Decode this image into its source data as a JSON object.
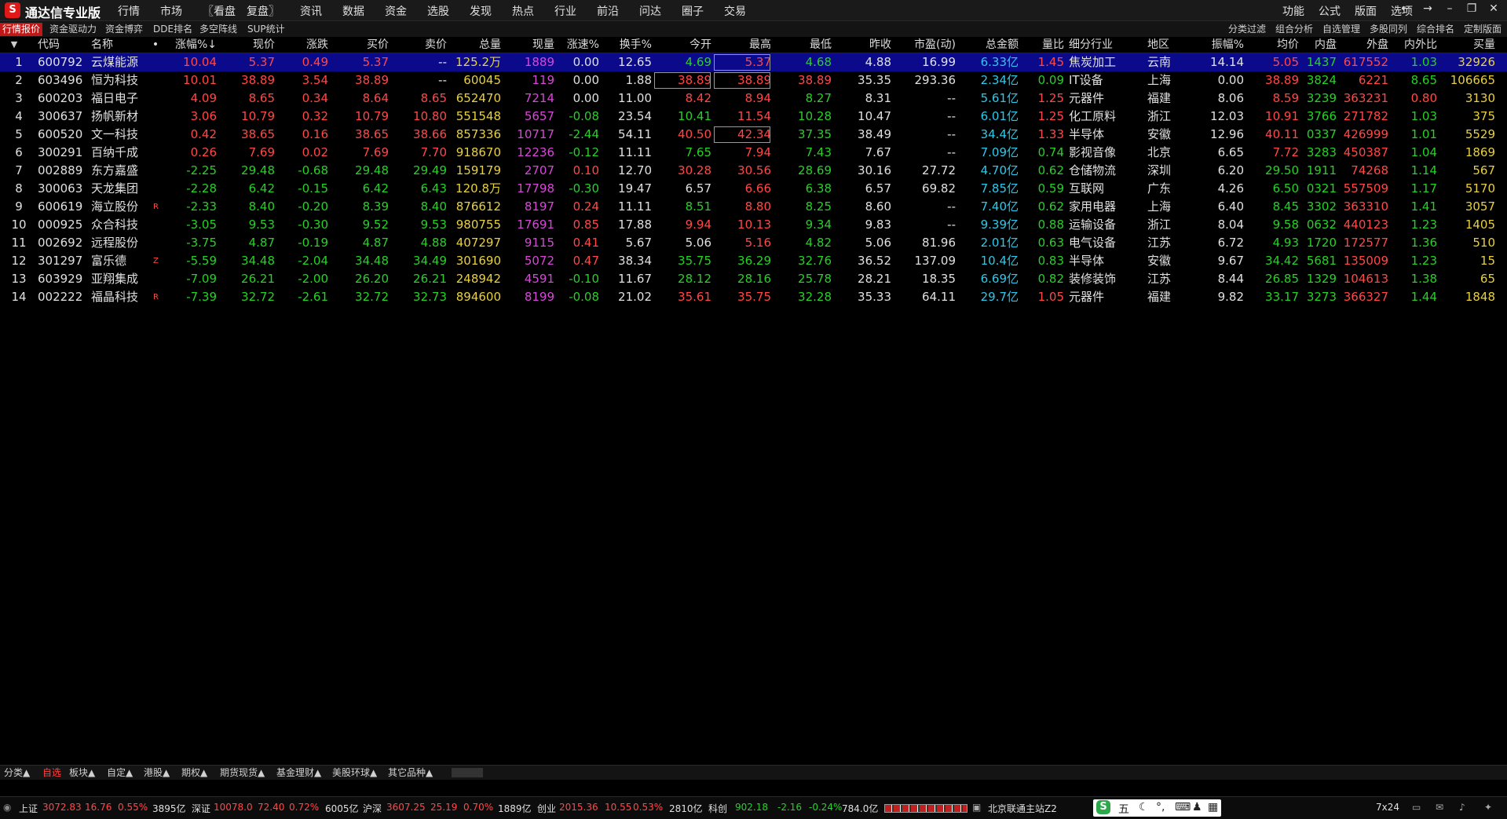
{
  "app": {
    "title": "通达信专业版",
    "menu": [
      "行情",
      "市场",
      "〖看盘",
      "复盘〗",
      "资讯",
      "数据",
      "资金",
      "选股",
      "发现",
      "热点",
      "行业",
      "前沿",
      "问达",
      "圈子",
      "交易"
    ],
    "right_menu": [
      "功能",
      "公式",
      "版面",
      "选项"
    ]
  },
  "top_tabs": [
    "行情报价",
    "资金驱动力",
    "资金博弈",
    "DDE排名",
    "多空阵线",
    "SUP统计"
  ],
  "right_tabs": [
    "分类过滤",
    "组合分析",
    "自选管理",
    "多股同列",
    "综合排名",
    "定制版面"
  ],
  "columns": [
    "",
    "代码",
    "名称",
    "•",
    "涨幅%↓",
    "现价",
    "涨跌",
    "买价",
    "卖价",
    "总量",
    "现量",
    "涨速%",
    "换手%",
    "今开",
    "最高",
    "最低",
    "昨收",
    "市盈(动)",
    "总金额",
    "量比",
    "细分行业",
    "地区",
    "振幅%",
    "均价",
    "内盘",
    "外盘",
    "内外比",
    "买量"
  ],
  "rows": [
    [
      "1",
      "600792",
      "云煤能源",
      "",
      "10.04",
      "5.37",
      "0.49",
      "5.37",
      "--",
      "125.2万",
      "1889",
      "0.00",
      "12.65",
      "4.69",
      "5.37",
      "4.68",
      "4.88",
      "16.99",
      "6.33亿",
      "1.45",
      "焦炭加工",
      "云南",
      "14.14",
      "5.05",
      "1437",
      "617552",
      "1.03",
      "32926"
    ],
    [
      "2",
      "603496",
      "恒为科技",
      "",
      "10.01",
      "38.89",
      "3.54",
      "38.89",
      "--",
      "60045",
      "119",
      "0.00",
      "1.88",
      "38.89",
      "38.89",
      "38.89",
      "35.35",
      "293.36",
      "2.34亿",
      "0.09",
      "IT设备",
      "上海",
      "0.00",
      "38.89",
      "3824",
      "6221",
      "8.65",
      "106665"
    ],
    [
      "3",
      "600203",
      "福日电子",
      "",
      "4.09",
      "8.65",
      "0.34",
      "8.64",
      "8.65",
      "652470",
      "7214",
      "0.00",
      "11.00",
      "8.42",
      "8.94",
      "8.27",
      "8.31",
      "--",
      "5.61亿",
      "1.25",
      "元器件",
      "福建",
      "8.06",
      "8.59",
      "3239",
      "363231",
      "0.80",
      "3130"
    ],
    [
      "4",
      "300637",
      "扬帆新材",
      "",
      "3.06",
      "10.79",
      "0.32",
      "10.79",
      "10.80",
      "551548",
      "5657",
      "-0.08",
      "23.54",
      "10.41",
      "11.54",
      "10.28",
      "10.47",
      "--",
      "6.01亿",
      "1.25",
      "化工原料",
      "浙江",
      "12.03",
      "10.91",
      "3766",
      "271782",
      "1.03",
      "375"
    ],
    [
      "5",
      "600520",
      "文一科技",
      "",
      "0.42",
      "38.65",
      "0.16",
      "38.65",
      "38.66",
      "857336",
      "10717",
      "-2.44",
      "54.11",
      "40.50",
      "42.34",
      "37.35",
      "38.49",
      "--",
      "34.4亿",
      "1.33",
      "半导体",
      "安徽",
      "12.96",
      "40.11",
      "0337",
      "426999",
      "1.01",
      "5529"
    ],
    [
      "6",
      "300291",
      "百纳千成",
      "",
      "0.26",
      "7.69",
      "0.02",
      "7.69",
      "7.70",
      "918670",
      "12236",
      "-0.12",
      "11.11",
      "7.65",
      "7.94",
      "7.43",
      "7.67",
      "--",
      "7.09亿",
      "0.74",
      "影视音像",
      "北京",
      "6.65",
      "7.72",
      "3283",
      "450387",
      "1.04",
      "1869"
    ],
    [
      "7",
      "002889",
      "东方嘉盛",
      "",
      "-2.25",
      "29.48",
      "-0.68",
      "29.48",
      "29.49",
      "159179",
      "2707",
      "0.10",
      "12.70",
      "30.28",
      "30.56",
      "28.69",
      "30.16",
      "27.72",
      "4.70亿",
      "0.62",
      "仓储物流",
      "深圳",
      "6.20",
      "29.50",
      "1911",
      "74268",
      "1.14",
      "567"
    ],
    [
      "8",
      "300063",
      "天龙集团",
      "",
      "-2.28",
      "6.42",
      "-0.15",
      "6.42",
      "6.43",
      "120.8万",
      "17798",
      "-0.30",
      "19.47",
      "6.57",
      "6.66",
      "6.38",
      "6.57",
      "69.82",
      "7.85亿",
      "0.59",
      "互联网",
      "广东",
      "4.26",
      "6.50",
      "0321",
      "557509",
      "1.17",
      "5170"
    ],
    [
      "9",
      "600619",
      "海立股份",
      "R",
      "-2.33",
      "8.40",
      "-0.20",
      "8.39",
      "8.40",
      "876612",
      "8197",
      "0.24",
      "11.11",
      "8.51",
      "8.80",
      "8.25",
      "8.60",
      "--",
      "7.40亿",
      "0.62",
      "家用电器",
      "上海",
      "6.40",
      "8.45",
      "3302",
      "363310",
      "1.41",
      "3057"
    ],
    [
      "10",
      "000925",
      "众合科技",
      "",
      "-3.05",
      "9.53",
      "-0.30",
      "9.52",
      "9.53",
      "980755",
      "17691",
      "0.85",
      "17.88",
      "9.94",
      "10.13",
      "9.34",
      "9.83",
      "--",
      "9.39亿",
      "0.88",
      "运输设备",
      "浙江",
      "8.04",
      "9.58",
      "0632",
      "440123",
      "1.23",
      "1405"
    ],
    [
      "11",
      "002692",
      "远程股份",
      "",
      "-3.75",
      "4.87",
      "-0.19",
      "4.87",
      "4.88",
      "407297",
      "9115",
      "0.41",
      "5.67",
      "5.06",
      "5.16",
      "4.82",
      "5.06",
      "81.96",
      "2.01亿",
      "0.63",
      "电气设备",
      "江苏",
      "6.72",
      "4.93",
      "1720",
      "172577",
      "1.36",
      "510"
    ],
    [
      "12",
      "301297",
      "富乐德",
      "Z",
      "-5.59",
      "34.48",
      "-2.04",
      "34.48",
      "34.49",
      "301690",
      "5072",
      "0.47",
      "38.34",
      "35.75",
      "36.29",
      "32.76",
      "36.52",
      "137.09",
      "10.4亿",
      "0.83",
      "半导体",
      "安徽",
      "9.67",
      "34.42",
      "5681",
      "135009",
      "1.23",
      "15"
    ],
    [
      "13",
      "603929",
      "亚翔集成",
      "",
      "-7.09",
      "26.21",
      "-2.00",
      "26.20",
      "26.21",
      "248942",
      "4591",
      "-0.10",
      "11.67",
      "28.12",
      "28.16",
      "25.78",
      "28.21",
      "18.35",
      "6.69亿",
      "0.82",
      "装修装饰",
      "江苏",
      "8.44",
      "26.85",
      "1329",
      "104613",
      "1.38",
      "65"
    ],
    [
      "14",
      "002222",
      "福晶科技",
      "R",
      "-7.39",
      "32.72",
      "-2.61",
      "32.72",
      "32.73",
      "894600",
      "8199",
      "-0.08",
      "21.02",
      "35.61",
      "35.75",
      "32.28",
      "35.33",
      "64.11",
      "29.7亿",
      "1.05",
      "元器件",
      "福建",
      "9.82",
      "33.17",
      "3273",
      "366327",
      "1.44",
      "1848"
    ]
  ],
  "bottom_tabs": [
    "分类▲",
    "自选",
    "板块▲",
    "自定▲",
    "港股▲",
    "期权▲",
    "期货现货▲",
    "基金理财▲",
    "美股环球▲",
    "其它品种▲"
  ],
  "status": {
    "sh_label": "上证",
    "sh_index": "3072.83",
    "sh_chg": "16.76",
    "sh_pct": "0.55%",
    "sh_amt": "3895亿",
    "sz_label": "深证",
    "sz_index": "10078.0",
    "sz_chg": "72.40",
    "sz_pct": "0.72%",
    "sz_amt": "6005亿",
    "hs_label": "沪深",
    "hs_index": "3607.25",
    "hs_chg": "25.19",
    "hs_pct": "0.70%",
    "hs_amt": "1889亿",
    "cy_label": "创业",
    "cy_index": "2015.36",
    "cy_chg": "10.55",
    "cy_pct": "0.53%",
    "cy_amt": "2810亿",
    "kc_label": "科创",
    "kc_index": "902.18",
    "kc_chg": "-2.16",
    "kc_pct": "-0.24%",
    "kc_amt": "784.0亿",
    "server": "北京联通主站Z2",
    "ime_text": "五",
    "clock": "7x24"
  },
  "colors": {
    "up": "#ff4848",
    "down": "#28d028",
    "accent": "#c01818",
    "selected_row": "#0a0a8a"
  }
}
